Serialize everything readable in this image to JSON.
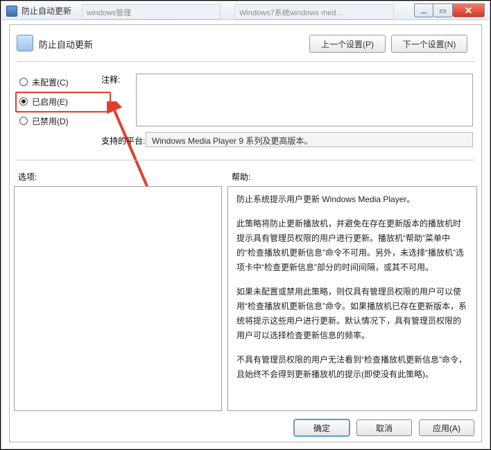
{
  "window": {
    "title": "防止自动更新",
    "tabs": {
      "bg1": "windows管理",
      "bg2": "Windows7系统windows med…"
    }
  },
  "dialog": {
    "heading": "防止自动更新",
    "prev_btn": "上一个设置(P)",
    "next_btn": "下一个设置(N)",
    "radios": {
      "not_configured": "未配置(C)",
      "enabled": "已启用(E)",
      "disabled": "已禁用(D)",
      "selected": "enabled"
    },
    "labels": {
      "comment": "注释:",
      "platform": "支持的平台:",
      "options": "选项:",
      "help": "帮助:"
    },
    "comment_text": "",
    "platform_text": "Windows Media Player 9 系列及更高版本。",
    "help": {
      "p1": "防止系统提示用户更新 Windows Media Player。",
      "p2": "此策略将防止更新播放机，并避免在存在更新版本的播放机时提示具有管理员权限的用户进行更新。播放机“帮助”菜单中的“检查播放机更新信息”命令不可用。另外，未选择“播放机”选项卡中“检查更新信息”部分的时间间隔，或其不可用。",
      "p3": "如果未配置或禁用此策略，则仅具有管理员权限的用户可以使用“检查播放机更新信息”命令。如果播放机已存在更新版本，系统将提示这些用户进行更新。默认情况下，具有管理员权限的用户可以选择检查更新信息的频率。",
      "p4": "不具有管理员权限的用户无法看到“检查播放机更新信息”命令，且始终不会得到更新播放机的提示(即使没有此策略)。"
    },
    "buttons": {
      "ok": "确定",
      "cancel": "取消",
      "apply": "应用(A)"
    }
  }
}
